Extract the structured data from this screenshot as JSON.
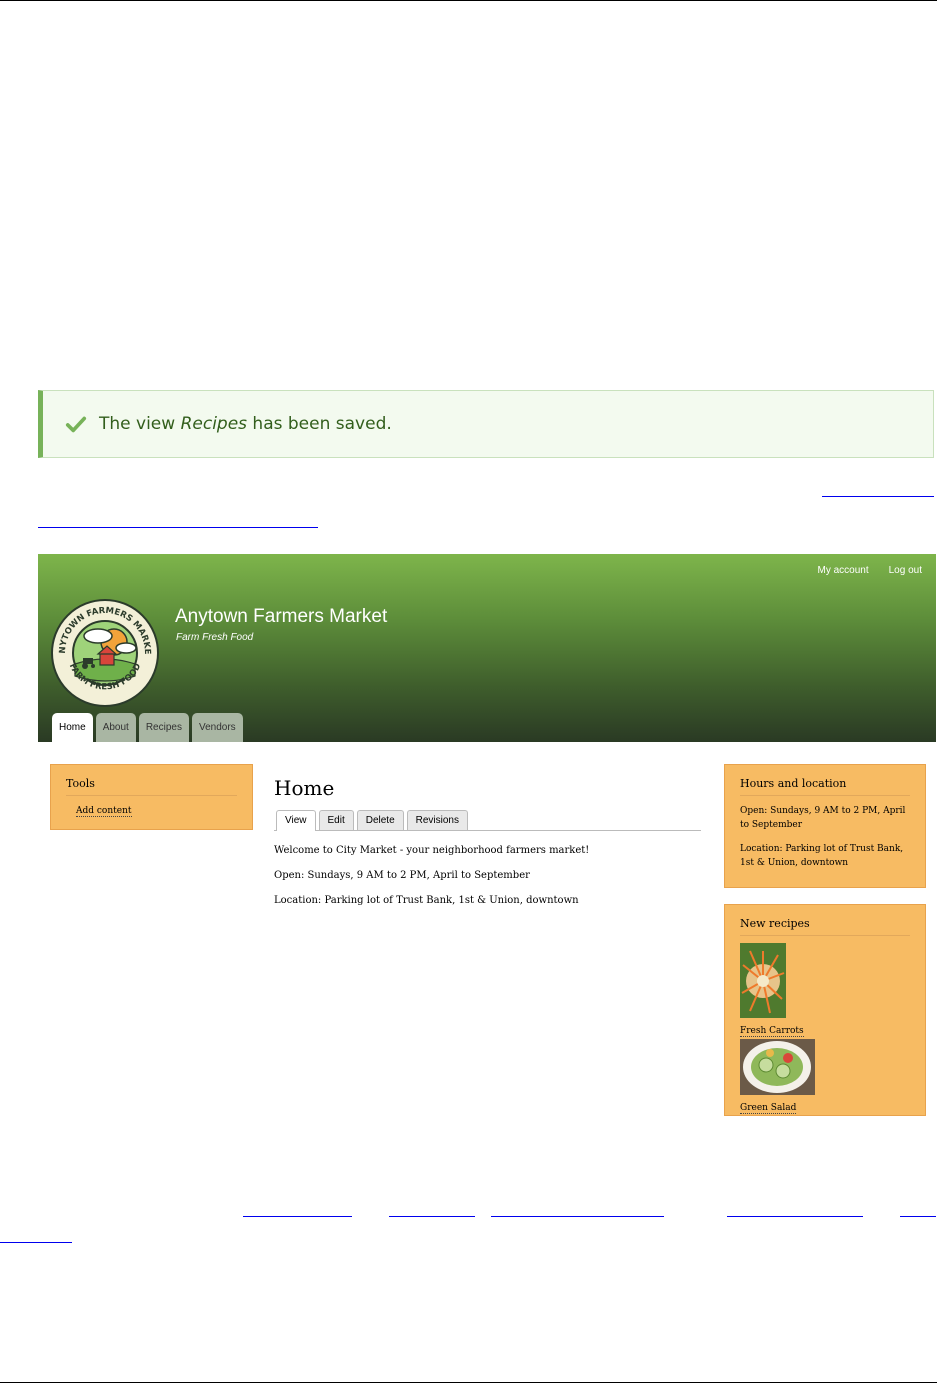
{
  "status": {
    "prefix": "The view ",
    "view_name": "Recipes",
    "suffix": " has been saved."
  },
  "site": {
    "name": "Anytown Farmers Market",
    "slogan": "Farm Fresh Food",
    "logo_text_top": "ANYTOWN FARMERS MARKET",
    "logo_text_bottom": "FARM FRESH FOOD",
    "user_menu": [
      "My account",
      "Log out"
    ],
    "tabs": [
      "Home",
      "About",
      "Recipes",
      "Vendors"
    ],
    "active_tab": "Home"
  },
  "sidebar_first": {
    "title": "Tools",
    "link": "Add content"
  },
  "main": {
    "title": "Home",
    "local_tabs": [
      "View",
      "Edit",
      "Delete",
      "Revisions"
    ],
    "paragraphs": [
      "Welcome to City Market - your neighborhood farmers market!",
      "Open: Sundays, 9 AM to 2 PM, April to September",
      "Location: Parking lot of Trust Bank, 1st & Union, downtown"
    ]
  },
  "hours_block": {
    "title": "Hours and location",
    "open_label": "Open:",
    "open_bold": " Sundays, 9 AM to 2 PM, April to September",
    "location_label": "Location:",
    "location_bold": " Parking lot of Trust Bank, 1st & Union, downtown"
  },
  "recipes_block": {
    "title": "New recipes",
    "items": [
      "Fresh Carrots",
      "Green Salad"
    ]
  },
  "colors": {
    "accent_green": "#77b259",
    "block_orange": "#f7bb63"
  }
}
